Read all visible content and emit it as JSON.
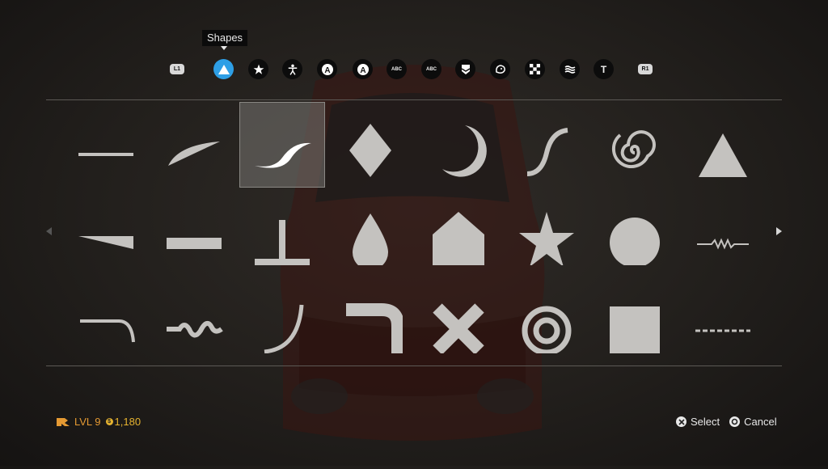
{
  "tooltip": {
    "label": "Shapes"
  },
  "bumpers": {
    "left": "L1",
    "right": "R1"
  },
  "categories": [
    {
      "icon": "triangle-icon",
      "text": "",
      "active": true
    },
    {
      "icon": "star-icon",
      "text": "",
      "active": false
    },
    {
      "icon": "person-icon",
      "text": "",
      "active": false
    },
    {
      "icon": "letter-a-outline-icon",
      "text": "A",
      "active": false
    },
    {
      "icon": "letter-a-icon",
      "text": "A",
      "active": false
    },
    {
      "icon": "text-abc-icon",
      "text": "ABC",
      "active": false
    },
    {
      "icon": "text-abc-alt-icon",
      "text": "ABC",
      "active": false
    },
    {
      "icon": "badge-icon",
      "text": "",
      "active": false
    },
    {
      "icon": "emblem-icon",
      "text": "",
      "active": false
    },
    {
      "icon": "checkered-flag-icon",
      "text": "",
      "active": false
    },
    {
      "icon": "waves-icon",
      "text": "",
      "active": false
    },
    {
      "icon": "text-t-icon",
      "text": "T",
      "active": false
    }
  ],
  "shapes": [
    [
      "horizontal-line-shape",
      "curved-blade-shape",
      "s-swoosh-shape",
      "diamond-shape",
      "crescent-shape",
      "s-curve-shape",
      "spiral-shape",
      "triangle-shape"
    ],
    [
      "wedge-shape",
      "rectangle-bar-shape",
      "t-beam-shape",
      "teardrop-shape",
      "house-pentagon-shape",
      "star-shape",
      "circle-shape",
      "zigzag-line-shape"
    ],
    [
      "curved-corner-line-shape",
      "squiggle-shape",
      "quarter-arc-shape",
      "thick-corner-shape",
      "x-cross-shape",
      "concentric-rings-shape",
      "square-shape",
      "dashed-line-shape"
    ]
  ],
  "selected_shape": "s-swoosh-shape",
  "player": {
    "level": "LVL 9",
    "credits": "1,180"
  },
  "prompts": {
    "select": "Select",
    "cancel": "Cancel"
  },
  "colors": {
    "accent": "#2e9fe6",
    "shape": "#c4c2bf",
    "selected_shape": "#ffffff",
    "level": "#e59a33",
    "credits": "#e5b22f"
  }
}
